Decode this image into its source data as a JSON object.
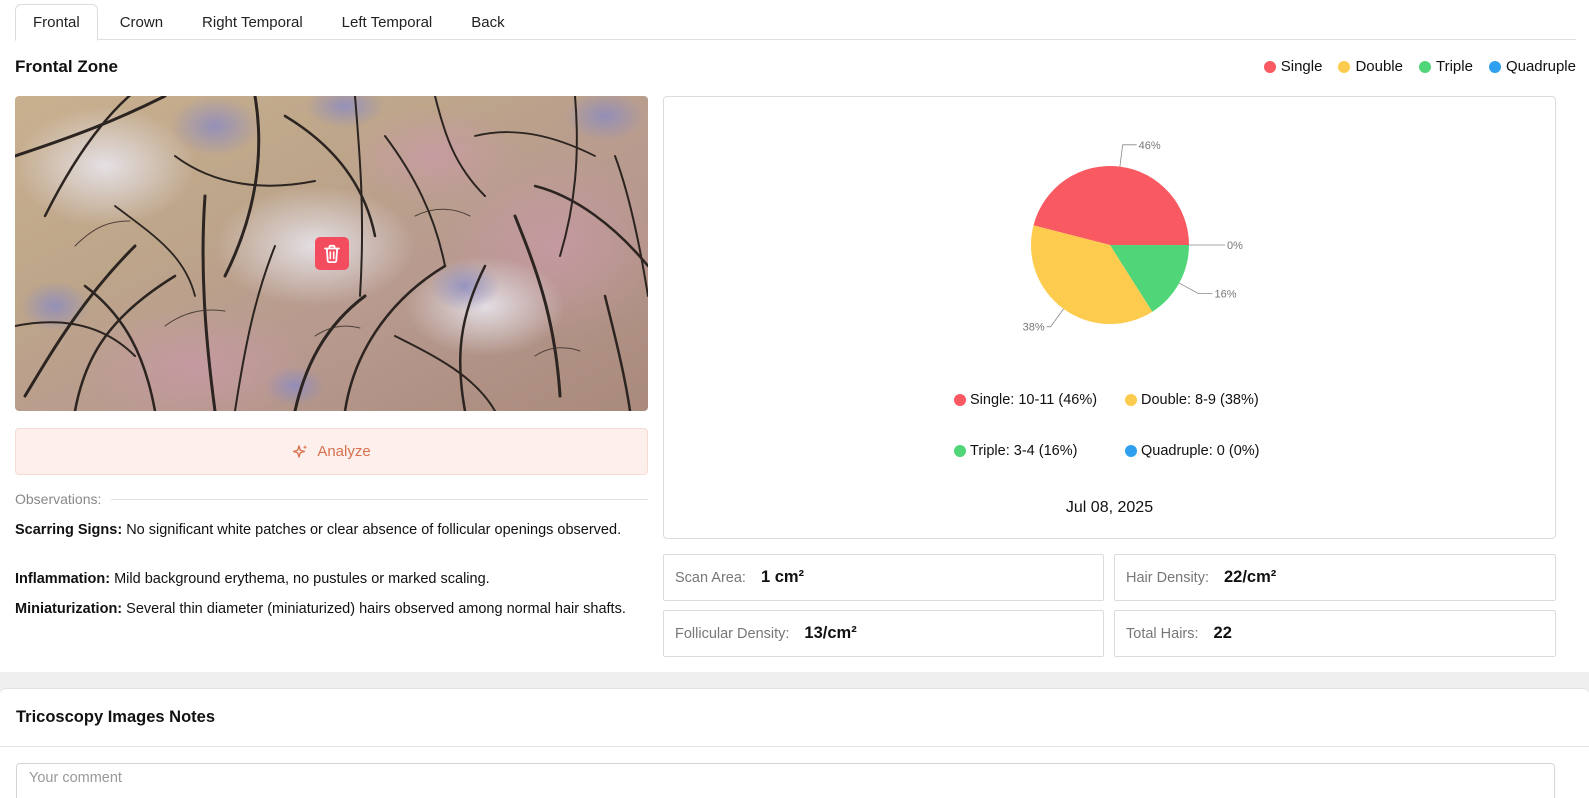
{
  "tabs": [
    {
      "label": "Frontal",
      "active": true
    },
    {
      "label": "Crown"
    },
    {
      "label": "Right Temporal"
    },
    {
      "label": "Left Temporal"
    },
    {
      "label": "Back"
    }
  ],
  "zone": {
    "title": "Frontal Zone"
  },
  "legend_top": [
    {
      "label": "Single",
      "color": "#f95a62"
    },
    {
      "label": "Double",
      "color": "#fdcc4e"
    },
    {
      "label": "Triple",
      "color": "#50d678"
    },
    {
      "label": "Quadruple",
      "color": "#2f9ff0"
    }
  ],
  "image": {
    "delete_icon": "trash-icon"
  },
  "analyze": {
    "label": "Analyze",
    "icon": "sparkle-icon"
  },
  "observations": {
    "header": "Observations:",
    "items": [
      {
        "label": "Scarring Signs:",
        "text": "No significant white patches or clear absence of follicular openings observed."
      },
      {
        "label": "Inflammation:",
        "text": "Mild background erythema, no pustules or marked scaling."
      },
      {
        "label": "Miniaturization:",
        "text": "Several thin diameter (miniaturized) hairs observed among normal hair shafts."
      }
    ]
  },
  "chart_data": {
    "type": "pie",
    "slices": [
      {
        "label": "Single",
        "value": 46,
        "pct_label": "46%",
        "legend": "Single: 10-11 (46%)",
        "color": "#f95a62"
      },
      {
        "label": "Double",
        "value": 38,
        "pct_label": "38%",
        "legend": "Double: 8-9 (38%)",
        "color": "#fdcc4e"
      },
      {
        "label": "Triple",
        "value": 16,
        "pct_label": "16%",
        "legend": "Triple: 3-4 (16%)",
        "color": "#50d678"
      },
      {
        "label": "Quadruple",
        "value": 0,
        "pct_label": "0%",
        "legend": "Quadruple: 0 (0%)",
        "color": "#2f9ff0"
      }
    ],
    "date": "Jul 08, 2025"
  },
  "stats": {
    "scan_area": {
      "label": "Scan Area:",
      "value": "1 cm²"
    },
    "hair_density": {
      "label": "Hair Density:",
      "value": "22/cm²"
    },
    "follicular_density": {
      "label": "Follicular Density:",
      "value": "13/cm²"
    },
    "total_hairs": {
      "label": "Total Hairs:",
      "value": "22"
    }
  },
  "notes": {
    "title": "Tricoscopy Images Notes",
    "placeholder": "Your comment",
    "value": ""
  }
}
